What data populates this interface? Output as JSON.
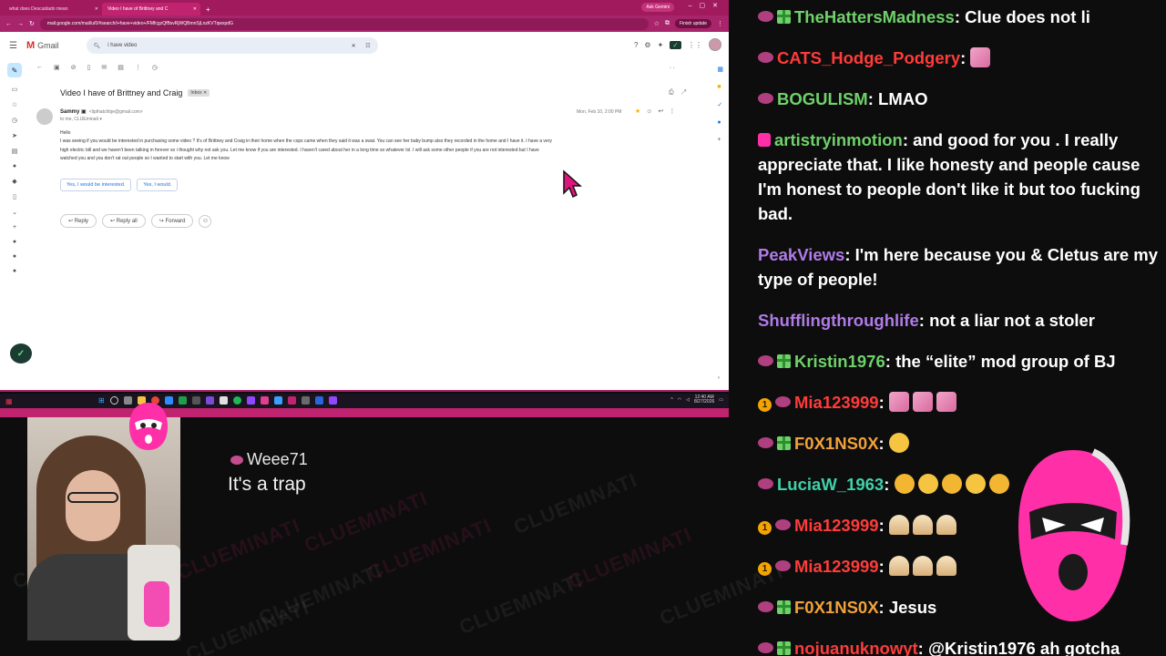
{
  "browser": {
    "tabs": [
      {
        "title": "what does Descuidado mean"
      },
      {
        "title": "Video I have of Brittney and C"
      }
    ],
    "ask_gemini": "Ask Gemini",
    "finish_update": "Finish update",
    "url": "mail.google.com/mail/u/0/#search/i+have+video+/FMfcgzQfBsvRjWQBmnSjLnzKVTqwxpdG"
  },
  "gmail": {
    "app_name": "Gmail",
    "search_value": "i have video",
    "subject": "Video I have of Brittney and Craig",
    "label": "Inbox",
    "sender_name": "Sammy",
    "sender_email": "<lipthatchbje@gmail.com>",
    "recipient": "to me, CLUEminati",
    "date": "Mon, Feb 10, 2:00 PM",
    "body_lines": [
      "Hello",
      "I was seeing if you would be interested in purchasing some video ? It's of Brittney and Craig in their home when the cops came when they said it was a swat. You can see her baby bump also they recorded in the home and I have it. I have a very",
      "high electric bill and we haven't been talking in forever so i thought why not ask you. Let me know if you are interested. I haven't cared about her in a long time so whatever lol. I will ask some other people if you are not interested but I have",
      "watched you and you don't rat out people so I wanted to start with you. Let me know"
    ],
    "smart_replies": [
      "Yes, I would be interested.",
      "Yes, I would."
    ],
    "actions": {
      "reply": "Reply",
      "reply_all": "Reply all",
      "forward": "Forward"
    }
  },
  "taskbar": {
    "time": "12:40 AM",
    "date": "8/27/2026"
  },
  "alert": {
    "username": "Weee71",
    "message": "It's a trap"
  },
  "watermark": "CLUEMINATI",
  "chat": [
    {
      "user": "TheHattersMadness",
      "user_color": "#6fd16a",
      "badges": [
        "blob",
        "gift"
      ],
      "text": "Clue does not li"
    },
    {
      "user": "CATS_Hodge_Podgery",
      "user_color": "#ff3b3b",
      "badges": [
        "blob"
      ],
      "text": ""
    },
    {
      "user": "BOGULISM",
      "user_color": "#6fd16a",
      "badges": [
        "blob"
      ],
      "text": "LMAO"
    },
    {
      "user": "artistryinmotion",
      "user_color": "#6fd16a",
      "badges": [
        "pinkbox"
      ],
      "text": "and good for you . I really appreciate that. I like honesty and people cause I'm honest to people don't like it but too fucking bad."
    },
    {
      "user": "PeakViews",
      "user_color": "#b07be8",
      "badges": [],
      "text": "I'm here because you & Cletus are my type of people!"
    },
    {
      "user": "Shufflingthroughlife",
      "user_color": "#b07be8",
      "badges": [],
      "text": "not a liar not a stoler"
    },
    {
      "user": "Kristin1976",
      "user_color": "#6fd16a",
      "badges": [
        "blob",
        "gift"
      ],
      "text": "the “elite” mod group of BJ"
    },
    {
      "user": "Mia123999",
      "user_color": "#ff3b3b",
      "badges": [
        "num",
        "blob"
      ],
      "text": ""
    },
    {
      "user": "F0X1NS0X",
      "user_color": "#f2a23a",
      "badges": [
        "blob",
        "gift"
      ],
      "text": ""
    },
    {
      "user": "LuciaW_1963",
      "user_color": "#3fd1a8",
      "badges": [
        "blob"
      ],
      "text": ""
    },
    {
      "user": "Mia123999",
      "user_color": "#ff3b3b",
      "badges": [
        "num",
        "blob"
      ],
      "text": ""
    },
    {
      "user": "Mia123999",
      "user_color": "#ff3b3b",
      "badges": [
        "num",
        "blob"
      ],
      "text": ""
    },
    {
      "user": "F0X1NS0X",
      "user_color": "#f2a23a",
      "badges": [
        "blob",
        "gift"
      ],
      "text": "Jesus"
    },
    {
      "user": "nojuanuknowyt",
      "user_color": "#ff3b3b",
      "badges": [
        "blob",
        "gift"
      ],
      "text": "@Kristin1976 ah gotcha"
    }
  ]
}
